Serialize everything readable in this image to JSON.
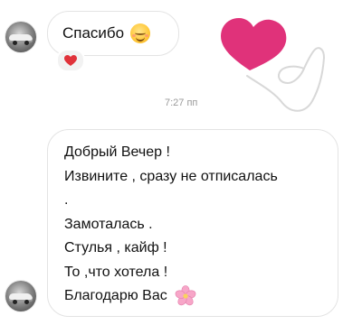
{
  "messages": [
    {
      "text": "Спасибо",
      "emoji": "smiling-face-icon",
      "reaction": "heart-icon"
    },
    {
      "lines": [
        "Добрый Вечер !",
        "Извините , сразу не отписалась",
        ".",
        "Замоталась .",
        "Стулья , кайф !",
        "То ,что хотела !",
        "Благодарю Вас"
      ],
      "trailing_emoji": "cherry-blossom-icon"
    }
  ],
  "timestamp": "7:27 пп",
  "sticker": "heart-sticker",
  "colors": {
    "bubble_border": "#e3e3e3",
    "heart_pink": "#e0327a",
    "reaction_heart": "#e0323a",
    "timestamp": "#9a9a9a"
  }
}
